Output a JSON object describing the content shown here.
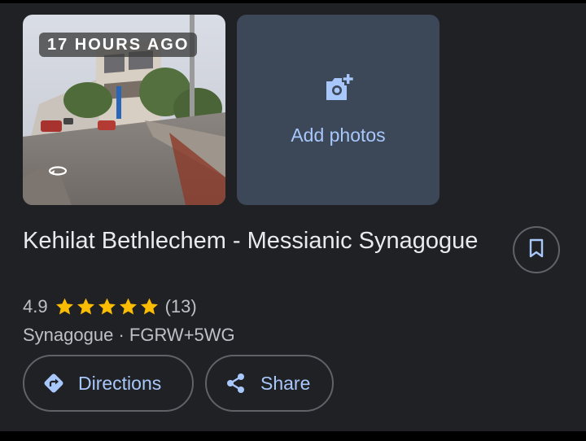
{
  "photo": {
    "timestamp_badge": "17 HOURS AGO",
    "icon": "street-view-rotate-icon"
  },
  "add_photos": {
    "icon": "add-photo-camera-icon",
    "label": "Add photos"
  },
  "place": {
    "name": "Kehilat Bethlechem - Messianic Synagogue",
    "rating": "4.9",
    "stars": 5,
    "review_count": "(13)",
    "category": "Synagogue",
    "separator": " · ",
    "plus_code": "FGRW+5WG"
  },
  "save": {
    "icon": "bookmark-icon"
  },
  "actions": {
    "directions_label": "Directions",
    "directions_icon": "directions-icon",
    "share_label": "Share",
    "share_icon": "share-icon"
  },
  "colors": {
    "background": "#202124",
    "accent": "#a8c7fa",
    "star": "#fbbc04",
    "add_photos_tile": "#3c4758"
  }
}
